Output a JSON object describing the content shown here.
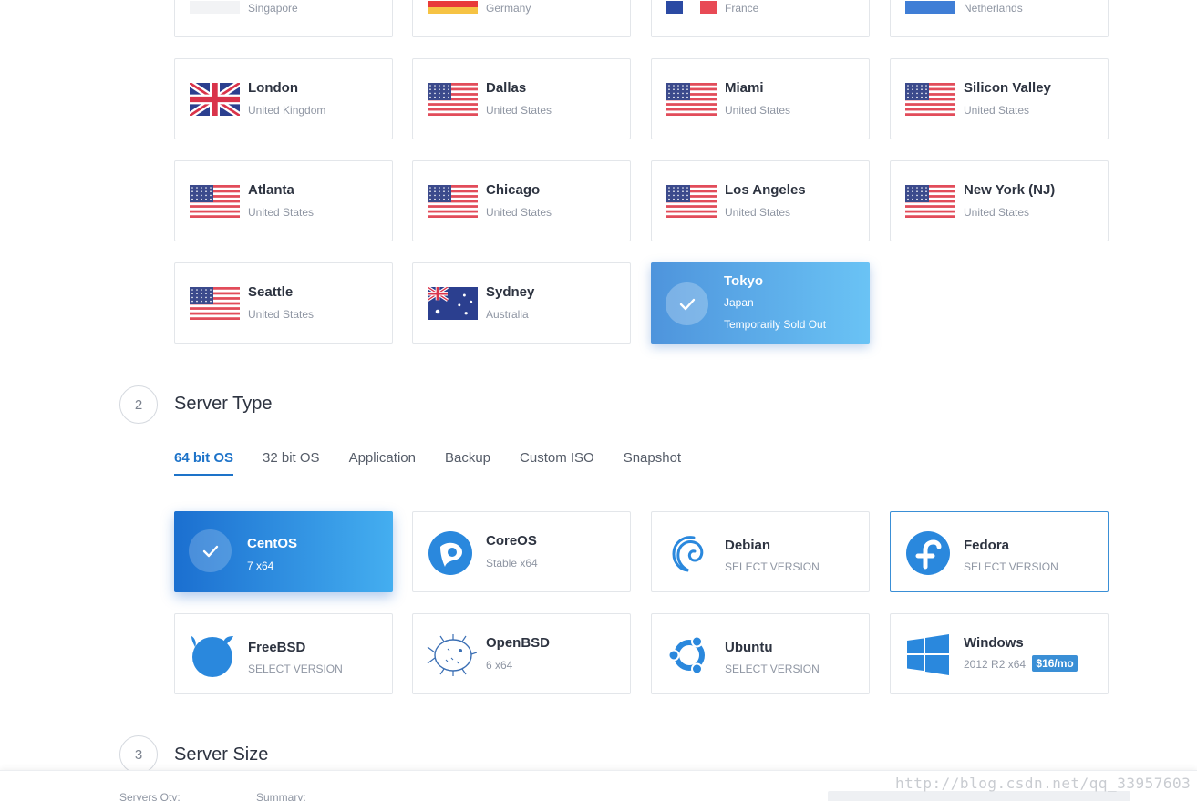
{
  "locations": [
    {
      "city": "",
      "country": "Singapore",
      "flag": "singapore-flag"
    },
    {
      "city": "",
      "country": "Germany",
      "flag": "germany-flag"
    },
    {
      "city": "",
      "country": "France",
      "flag": "france-flag"
    },
    {
      "city": "",
      "country": "Netherlands",
      "flag": "netherlands-flag"
    },
    {
      "city": "London",
      "country": "United Kingdom",
      "flag": "uk-flag"
    },
    {
      "city": "Dallas",
      "country": "United States",
      "flag": "us-flag"
    },
    {
      "city": "Miami",
      "country": "United States",
      "flag": "us-flag"
    },
    {
      "city": "Silicon Valley",
      "country": "United States",
      "flag": "us-flag"
    },
    {
      "city": "Atlanta",
      "country": "United States",
      "flag": "us-flag"
    },
    {
      "city": "Chicago",
      "country": "United States",
      "flag": "us-flag"
    },
    {
      "city": "Los Angeles",
      "country": "United States",
      "flag": "us-flag"
    },
    {
      "city": "New York (NJ)",
      "country": "United States",
      "flag": "us-flag"
    },
    {
      "city": "Seattle",
      "country": "United States",
      "flag": "us-flag"
    },
    {
      "city": "Sydney",
      "country": "Australia",
      "flag": "australia-flag"
    },
    {
      "city": "Tokyo",
      "country": "Japan",
      "status": "Temporarily Sold Out",
      "flag": "check-icon",
      "selected": true
    }
  ],
  "server_type": {
    "step": "2",
    "title": "Server Type",
    "tabs": [
      "64 bit OS",
      "32 bit OS",
      "Application",
      "Backup",
      "Custom ISO",
      "Snapshot"
    ],
    "active_tab": "64 bit OS",
    "os": [
      {
        "name": "CentOS",
        "detail": "7  x64",
        "icon": "check-icon",
        "selected": true
      },
      {
        "name": "CoreOS",
        "detail": "Stable  x64",
        "icon": "coreos-icon"
      },
      {
        "name": "Debian",
        "detail": "SELECT VERSION",
        "icon": "debian-icon"
      },
      {
        "name": "Fedora",
        "detail": "SELECT VERSION",
        "icon": "fedora-icon",
        "outlined": true
      },
      {
        "name": "FreeBSD",
        "detail": "SELECT VERSION",
        "icon": "freebsd-icon"
      },
      {
        "name": "OpenBSD",
        "detail": "6  x64",
        "icon": "openbsd-icon"
      },
      {
        "name": "Ubuntu",
        "detail": "SELECT VERSION",
        "icon": "ubuntu-icon"
      },
      {
        "name": "Windows",
        "detail": "2012 R2  x64",
        "icon": "windows-icon",
        "price": "$16/mo"
      }
    ]
  },
  "server_size": {
    "step": "3",
    "title": "Server Size"
  },
  "bottom": {
    "servers_qty_label": "Servers Qty:",
    "summary_label": "Summary:"
  },
  "watermark": "http://blog.csdn.net/qq_33957603",
  "colors": {
    "accent": "#1d73c9",
    "selected_gradient_start": "#4e94dc",
    "selected_gradient_end": "#6ac3f5"
  }
}
